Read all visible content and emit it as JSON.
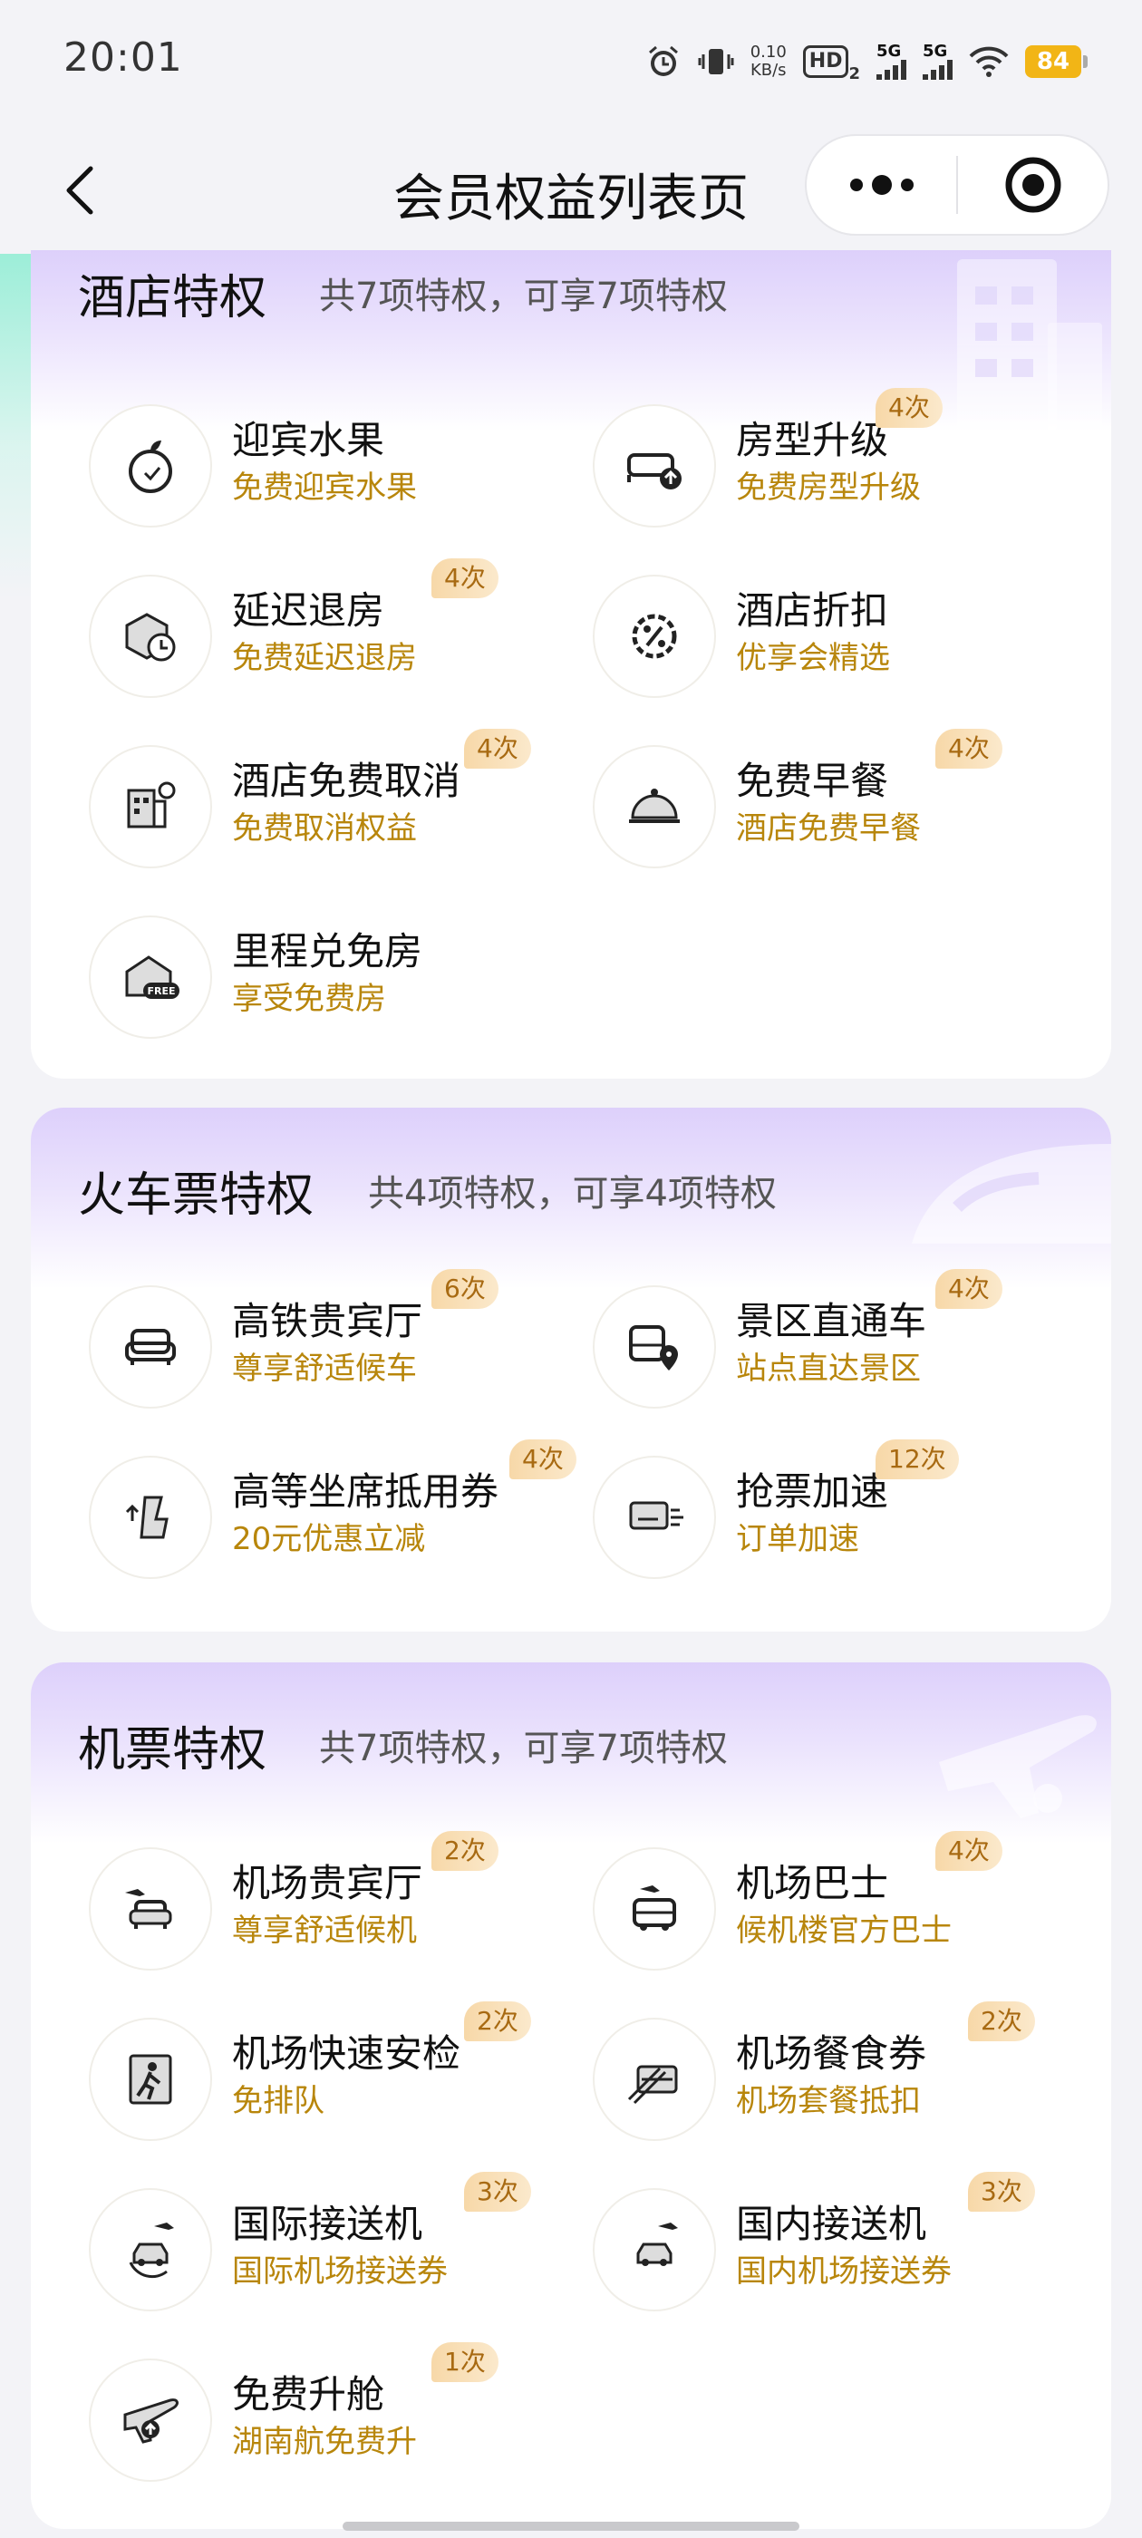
{
  "status_bar": {
    "time": "20:01",
    "net_speed": "0.10",
    "net_unit": "KB/s",
    "hd_label": "HD",
    "hd_sub": "2",
    "signal1_label": "5G",
    "signal2_label": "5G",
    "battery": "84"
  },
  "header": {
    "title": "会员权益列表页"
  },
  "hotel": {
    "title": "酒店特权",
    "subtitle": "共7项特权，可享7项特权",
    "items": [
      {
        "name": "迎宾水果",
        "desc": "免费迎宾水果",
        "badge": null
      },
      {
        "name": "房型升级",
        "desc": "免费房型升级",
        "badge": "4次"
      },
      {
        "name": "延迟退房",
        "desc": "免费延迟退房",
        "badge": "4次"
      },
      {
        "name": "酒店折扣",
        "desc": "优享会精选",
        "badge": null
      },
      {
        "name": "酒店免费取消",
        "desc": "免费取消权益",
        "badge": "4次"
      },
      {
        "name": "免费早餐",
        "desc": "酒店免费早餐",
        "badge": "4次"
      },
      {
        "name": "里程兑免房",
        "desc": "享受免费房",
        "badge": null
      }
    ]
  },
  "train": {
    "title": "火车票特权",
    "subtitle": "共4项特权，可享4项特权",
    "items": [
      {
        "name": "高铁贵宾厅",
        "desc": "尊享舒适候车",
        "badge": "6次"
      },
      {
        "name": "景区直通车",
        "desc": "站点直达景区",
        "badge": "4次"
      },
      {
        "name": "高等坐席抵用券",
        "desc": "20元优惠立减",
        "badge": "4次"
      },
      {
        "name": "抢票加速",
        "desc": "订单加速",
        "badge": "12次"
      }
    ]
  },
  "flight": {
    "title": "机票特权",
    "subtitle": "共7项特权，可享7项特权",
    "items": [
      {
        "name": "机场贵宾厅",
        "desc": "尊享舒适候机",
        "badge": "2次"
      },
      {
        "name": "机场巴士",
        "desc": "候机楼官方巴士",
        "badge": "4次"
      },
      {
        "name": "机场快速安检",
        "desc": "免排队",
        "badge": "2次"
      },
      {
        "name": "机场餐食券",
        "desc": "机场套餐抵扣",
        "badge": "2次"
      },
      {
        "name": "国际接送机",
        "desc": "国际机场接送券",
        "badge": "3次"
      },
      {
        "name": "国内接送机",
        "desc": "国内机场接送券",
        "badge": "3次"
      },
      {
        "name": "免费升舱",
        "desc": "湖南航免费升",
        "badge": "1次"
      }
    ]
  },
  "icons": {
    "fruit": "apple-icon",
    "upgrade": "sofa-upgrade-icon",
    "late": "box-clock-icon",
    "discount": "percent-gear-icon",
    "cancel": "building-cancel-icon",
    "breakfast": "cloche-icon",
    "free_room": "free-house-icon",
    "lounge": "armchair-icon",
    "shuttle": "bus-location-icon",
    "seat": "seat-up-icon",
    "speed": "fast-ticket-icon",
    "air_lounge": "plane-armchair-icon",
    "air_bus": "plane-bus-icon",
    "security": "walkthrough-icon",
    "meal": "meal-box-icon",
    "intl": "plane-car-icon",
    "domestic": "plane-car-icon",
    "cabin": "plane-up-icon"
  },
  "colors": {
    "accent_gold": "#b8860b",
    "badge_text": "#a86a12",
    "header_purple": "#ddd0fb",
    "battery": "#f2b516"
  }
}
